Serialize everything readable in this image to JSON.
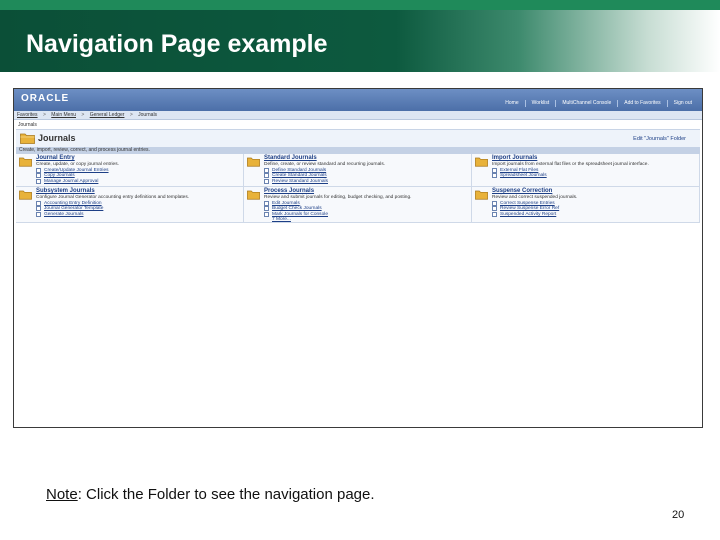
{
  "slide": {
    "title": "Navigation Page example",
    "note_label": "Note",
    "note_text": ":  Click the Folder to see the navigation page.",
    "page_number": "20"
  },
  "screenshot": {
    "logo": "ORACLE",
    "header_links": [
      "Home",
      "Worklist",
      "MultiChannel Console",
      "Add to Favorites",
      "Sign out"
    ],
    "breadcrumb": [
      "Favorites",
      "Main Menu",
      "General Ledger",
      "Journals"
    ],
    "breadcrumb_sep": ">",
    "page_label": "Journals",
    "folder_title": "Journals",
    "edit_link": "Edit \"Journals\" Folder",
    "folder_description": "Create, import, review, correct, and process journal entries.",
    "cells": [
      {
        "title": "Journal Entry",
        "desc": "Create, update, or copy journal entries.",
        "links": [
          "Create/Update Journal Entries",
          "Copy Journals",
          "Manage Journal Approval"
        ]
      },
      {
        "title": "Standard Journals",
        "desc": "Define, create, or review standard and recurring journals.",
        "links": [
          "Define Standard Journals",
          "Create Standard Journals",
          "Review Standard Journals"
        ]
      },
      {
        "title": "Import Journals",
        "desc": "Import journals from external flat files or the spreadsheet journal interface.",
        "links": [
          "External Flat Files",
          "Spreadsheet Journals"
        ]
      },
      {
        "title": "Subsystem Journals",
        "desc": "Configure Journal Generator accounting entry definitions and templates.",
        "links": [
          "Accounting Entry Definition",
          "Journal Generator Template",
          "Generate Journals"
        ]
      },
      {
        "title": "Process Journals",
        "desc": "Review and submit journals for editing, budget checking, and posting.",
        "links": [
          "Edit Journals",
          "Budget Check Journals",
          "Mark Journals for Console"
        ],
        "more": "7 More..."
      },
      {
        "title": "Suspense Correction",
        "desc": "Review and correct suspended journals.",
        "links": [
          "Correct Suspense Entries",
          "Review Suspense Error Ref",
          "Suspended Activity Report"
        ]
      }
    ]
  },
  "colors": {
    "header_dark_green": "#0b4f37",
    "header_light_green": "#1f8a5a",
    "ps_blue": "#4c6fa8",
    "link_blue": "#1d3f86",
    "folder_yellow": "#e8b23a"
  },
  "icons": {
    "folder": "folder-icon",
    "document": "document-icon"
  }
}
